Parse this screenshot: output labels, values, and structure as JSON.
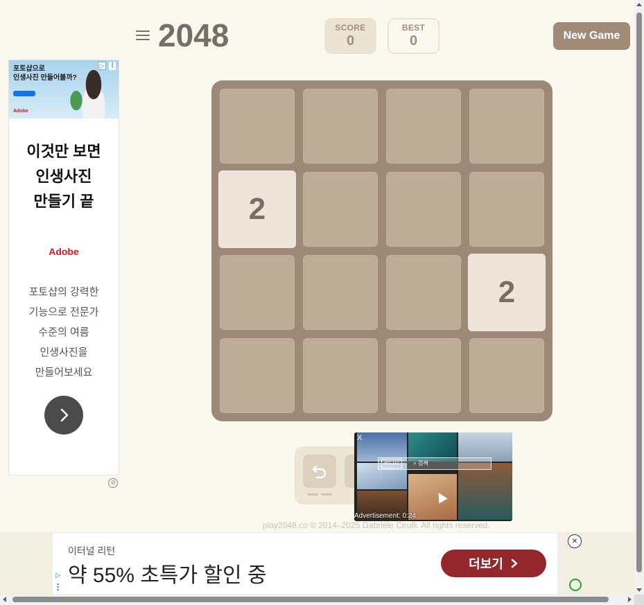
{
  "header": {
    "title": "2048",
    "score_label": "SCORE",
    "score_value": "0",
    "best_label": "BEST",
    "best_value": "0",
    "new_game_label": "New Game"
  },
  "board": {
    "size": 4,
    "tiles": [
      {
        "row": 1,
        "col": 0,
        "value": "2"
      },
      {
        "row": 2,
        "col": 3,
        "value": "2"
      }
    ]
  },
  "left_ad": {
    "banner_headline": "포토샵으로\n인생사진 만들어볼까?",
    "banner_brand": "Adobe",
    "headline": "이것만 보면\n인생사진\n만들기 끝",
    "brand": "Adobe",
    "body": "포토샵의 강력한\n기능으로 전문가\n수준의 여름\n인생사진을\n만들어보세요"
  },
  "video_ad": {
    "close": "X",
    "search_tag": "비디오",
    "search_text": "검색",
    "timer": "Advertisement: 0:24"
  },
  "footer": {
    "copyright": "play2048.co © 2014–2025 Gabriele Cirulli. All rights reserved."
  },
  "bottom_ad": {
    "brand": "이터널 리턴",
    "offer": "약 55% 초특가 할인 중",
    "cta": "더보기",
    "close": "×"
  },
  "colors": {
    "background": "#faf8ef",
    "board": "#9c8978",
    "cell": "#bdac97",
    "tile_2": "#eee4da",
    "text": "#776e65",
    "new_game_bg": "#9f8b77",
    "cta_red": "#93272c"
  }
}
